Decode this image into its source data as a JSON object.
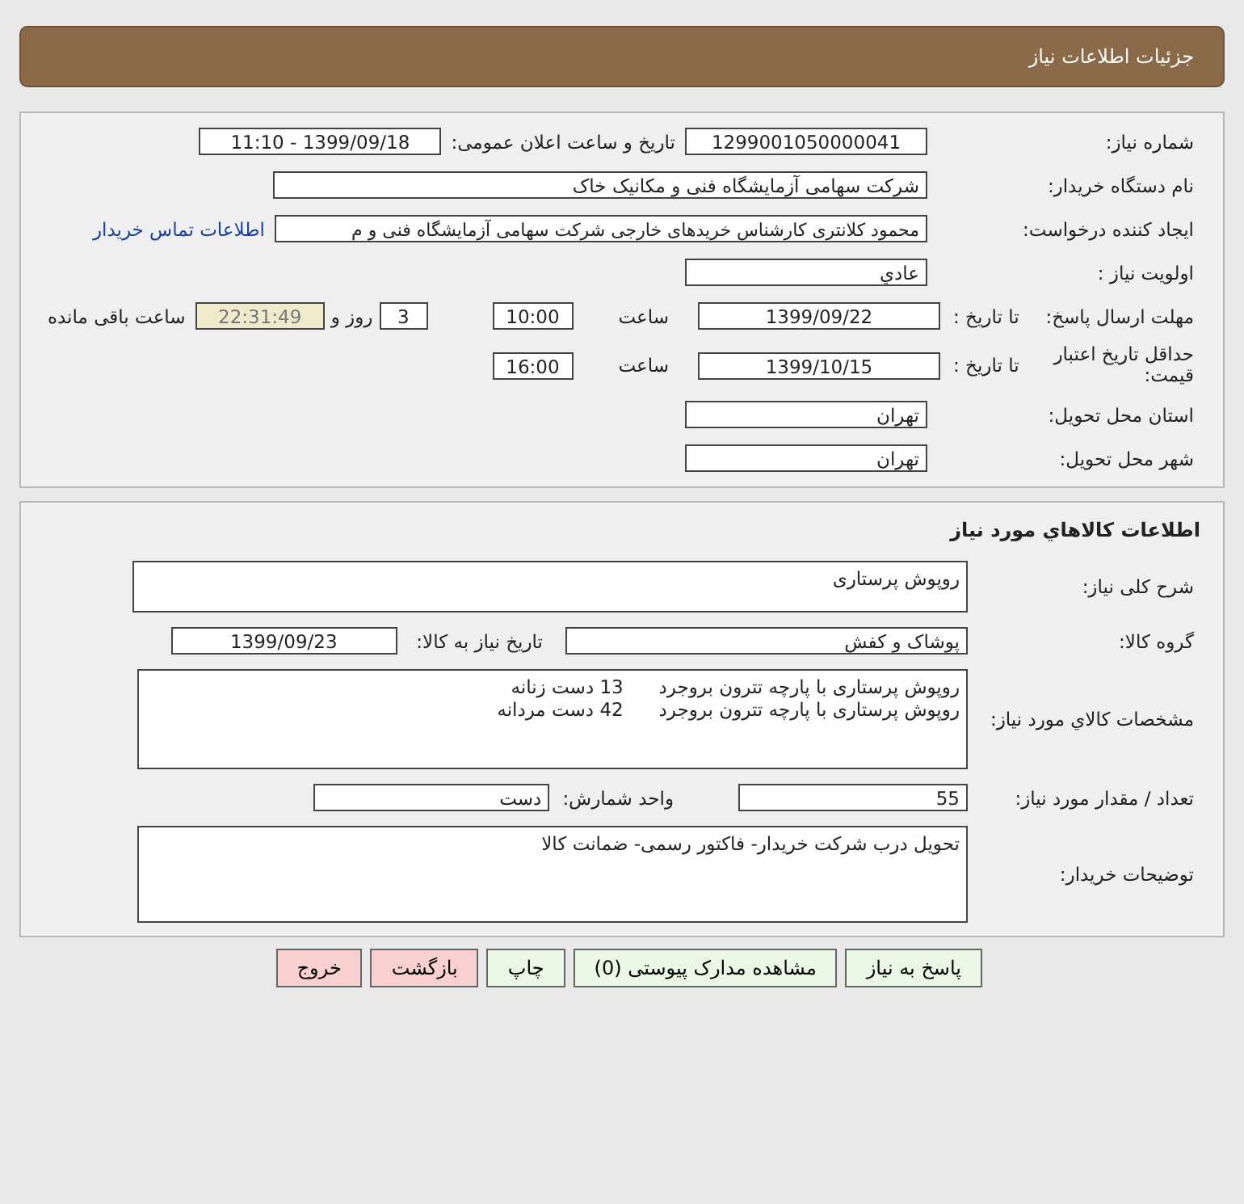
{
  "header": {
    "title": "جزئیات اطلاعات نیاز"
  },
  "request": {
    "need_number": {
      "label": "شماره نیاز:",
      "value": "1299001050000041"
    },
    "announce": {
      "label": "تاریخ و ساعت اعلان عمومی:",
      "value": "1399/09/18 - 11:10"
    },
    "buyer": {
      "label": "نام دستگاه خریدار:",
      "value": "شرکت سهامی آزمایشگاه فنی و مکانیک خاک"
    },
    "creator": {
      "label": "ایجاد کننده درخواست:",
      "value": "محمود کلانتری کارشناس خریدهای خارجی  شرکت سهامی آزمایشگاه فنی و م",
      "link": "اطلاعات تماس خریدار"
    },
    "priority": {
      "label": "اولویت نیاز :",
      "value": "عادي"
    },
    "deadline": {
      "label": "مهلت ارسال پاسخ:",
      "to_label": "تا تاریخ :",
      "date": "1399/09/22",
      "time_label": "ساعت",
      "time": "10:00",
      "days": "3",
      "days_label": "روز و",
      "remaining": "22:31:49",
      "remaining_label": "ساعت باقی مانده"
    },
    "validity": {
      "label": "حداقل تاریخ اعتبار قیمت:",
      "to_label": "تا تاریخ :",
      "date": "1399/10/15",
      "time_label": "ساعت",
      "time": "16:00"
    },
    "province": {
      "label": "استان محل تحویل:",
      "value": "تهران"
    },
    "city": {
      "label": "شهر محل تحویل:",
      "value": "تهران"
    }
  },
  "goods": {
    "title": "اطلاعات کالاهاي مورد نیاز",
    "summary": {
      "label": "شرح کلی نیاز:",
      "value": "روپوش پرستاری"
    },
    "group": {
      "label": "گروه کالا:",
      "value": "پوشاک و کفش"
    },
    "need_date": {
      "label": "تاریخ نیاز به کالا:",
      "value": "1399/09/23"
    },
    "specs": {
      "label": "مشخصات کالاي مورد نیاز:",
      "lines": [
        "روپوش پرستاری با پارچه تترون بروجرد      13 دست زنانه",
        "روپوش پرستاری با پارچه تترون بروجرد      42 دست مردانه"
      ]
    },
    "quantity": {
      "label": "تعداد / مقدار مورد نیاز:",
      "value": "55"
    },
    "unit": {
      "label": "واحد شمارش:",
      "value": "دست"
    },
    "notes": {
      "label": "توضیحات خریدار:",
      "value": "تحویل درب شرکت خریدار- فاکتور رسمی- ضمانت کالا"
    }
  },
  "buttons": [
    {
      "label": "پاسخ به نیاز",
      "kind": "primary"
    },
    {
      "label": "مشاهده مدارک پیوستی (0)",
      "kind": "primary"
    },
    {
      "label": "چاپ",
      "kind": "primary"
    },
    {
      "label": "بازگشت",
      "kind": "danger"
    },
    {
      "label": "خروج",
      "kind": "danger"
    }
  ]
}
